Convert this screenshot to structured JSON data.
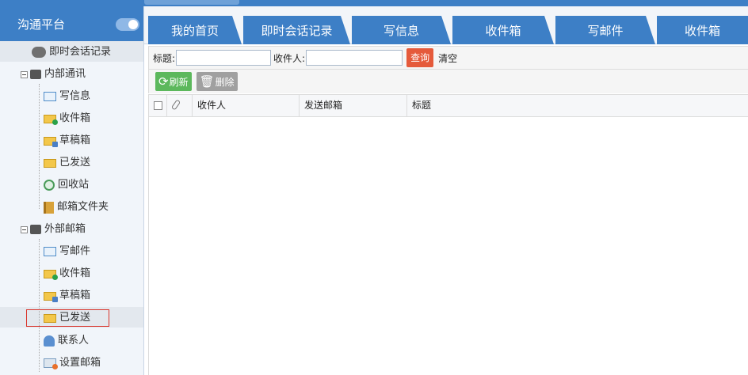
{
  "sidebar": {
    "title": "沟通平台",
    "items": [
      {
        "label": "即时会话记录",
        "icon": "chat-bubble-icon"
      },
      {
        "label": "内部通讯",
        "icon": "mailbox-icon"
      },
      {
        "label": "写信息",
        "icon": "write-icon"
      },
      {
        "label": "收件箱",
        "icon": "inbox-icon"
      },
      {
        "label": "草稿箱",
        "icon": "draft-icon"
      },
      {
        "label": "已发送",
        "icon": "sent-icon"
      },
      {
        "label": "回收站",
        "icon": "recycle-icon"
      },
      {
        "label": "邮箱文件夹",
        "icon": "folder-icon"
      },
      {
        "label": "外部邮箱",
        "icon": "mailbox-icon"
      },
      {
        "label": "写邮件",
        "icon": "write-icon"
      },
      {
        "label": "收件箱",
        "icon": "inbox-icon"
      },
      {
        "label": "草稿箱",
        "icon": "draft-icon"
      },
      {
        "label": "已发送",
        "icon": "sent-icon"
      },
      {
        "label": "联系人",
        "icon": "contact-icon"
      },
      {
        "label": "设置邮箱",
        "icon": "mail-settings-icon"
      }
    ]
  },
  "tabs": [
    {
      "label": "我的首页"
    },
    {
      "label": "即时会话记录"
    },
    {
      "label": "写信息"
    },
    {
      "label": "收件箱"
    },
    {
      "label": "写邮件"
    },
    {
      "label": "收件箱"
    }
  ],
  "search": {
    "title_label": "标题:",
    "title_value": "",
    "recipient_label": "收件人:",
    "recipient_value": "",
    "query_button": "查询",
    "clear_button": "清空"
  },
  "toolbar": {
    "refresh_label": "刷新",
    "delete_label": "删除"
  },
  "grid": {
    "columns": [
      "收件人",
      "发送邮箱",
      "标题"
    ]
  },
  "colors": {
    "primary": "#3d7fc6",
    "query": "#e55a3b",
    "refresh": "#5cb85c",
    "delete": "#a0a0a0",
    "selection": "#d9342b"
  }
}
